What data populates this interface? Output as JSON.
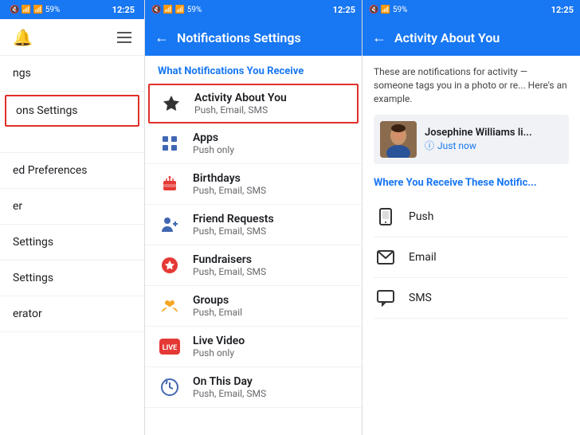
{
  "panel1": {
    "status": {
      "time": "12:25",
      "battery": "59%",
      "signal": "4G"
    },
    "nav": {
      "bell": "🔔",
      "menu": "☰"
    },
    "menu_items": [
      {
        "label": "ngs",
        "highlighted": false
      },
      {
        "label": "ons Settings",
        "highlighted": true
      },
      {
        "label": "",
        "highlighted": false
      },
      {
        "label": "ed Preferences",
        "highlighted": false
      },
      {
        "label": "er",
        "highlighted": false
      },
      {
        "label": "Settings",
        "highlighted": false
      },
      {
        "label": "Settings",
        "highlighted": false
      },
      {
        "label": "erator",
        "highlighted": false
      }
    ]
  },
  "panel2": {
    "title": "Notifications Settings",
    "section_heading": "What Notifications You Receive",
    "items": [
      {
        "icon": "star",
        "icon_color": "#333",
        "title": "Activity About You",
        "subtitle": "Push, Email, SMS",
        "highlighted": true
      },
      {
        "icon": "cube",
        "icon_color": "#4267B2",
        "title": "Apps",
        "subtitle": "Push only",
        "highlighted": false
      },
      {
        "icon": "cake",
        "icon_color": "#e53935",
        "title": "Birthdays",
        "subtitle": "Push, Email, SMS",
        "highlighted": false
      },
      {
        "icon": "friend",
        "icon_color": "#4267B2",
        "title": "Friend Requests",
        "subtitle": "Push, Email, SMS",
        "highlighted": false
      },
      {
        "icon": "heart",
        "icon_color": "#e53935",
        "title": "Fundraisers",
        "subtitle": "Push, Email, SMS",
        "highlighted": false
      },
      {
        "icon": "group",
        "icon_color": "#f5a623",
        "title": "Groups",
        "subtitle": "Push, Email",
        "highlighted": false
      },
      {
        "icon": "live",
        "icon_color": "#e53935",
        "title": "Live Video",
        "subtitle": "Push only",
        "highlighted": false
      },
      {
        "icon": "clock",
        "icon_color": "#4267B2",
        "title": "On This Day",
        "subtitle": "Push, Email, SMS",
        "highlighted": false
      }
    ]
  },
  "panel3": {
    "title": "Activity About You",
    "description": "These are notifications for activity — someone tags you in a photo or re... Here's an example.",
    "example": {
      "name": "Josephine Williams li...",
      "time": "Just now"
    },
    "where_heading": "Where You Receive These Notific...",
    "receive_items": [
      {
        "icon": "push",
        "label": "Push"
      },
      {
        "icon": "email",
        "label": "Email"
      },
      {
        "icon": "sms",
        "label": "SMS"
      }
    ]
  }
}
